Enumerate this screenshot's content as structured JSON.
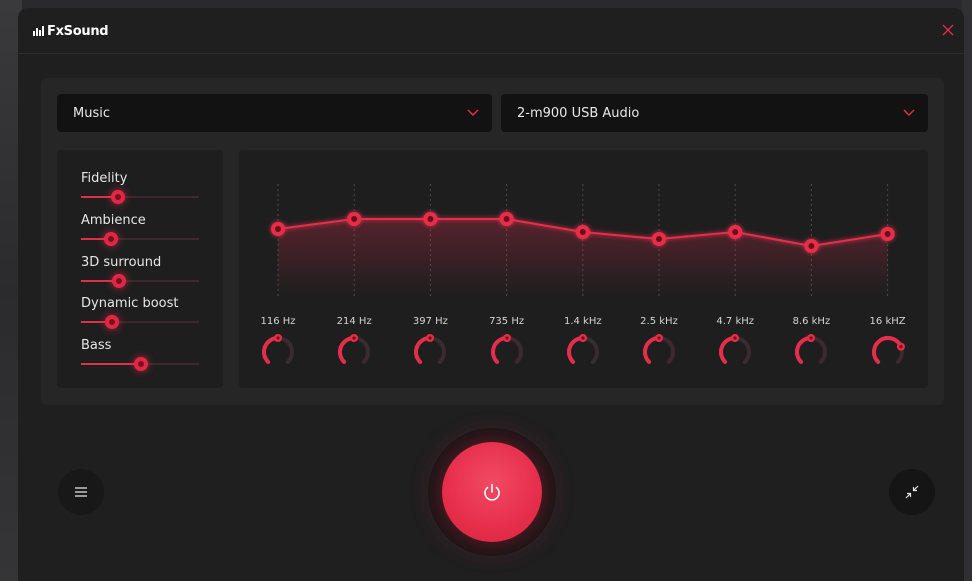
{
  "app": {
    "name": "FxSound"
  },
  "colors": {
    "accent": "#e62e4b",
    "background": "#1f1f20",
    "panel": "#262627"
  },
  "preset_dropdown": {
    "value": "Music"
  },
  "output_dropdown": {
    "value": "2-m900 USB Audio"
  },
  "effects": [
    {
      "label": "Fidelity",
      "value": 0.31
    },
    {
      "label": "Ambience",
      "value": 0.25
    },
    {
      "label": "3D surround",
      "value": 0.32
    },
    {
      "label": "Dynamic boost",
      "value": 0.26
    },
    {
      "label": "Bass",
      "value": 0.51
    }
  ],
  "eq": {
    "bands": [
      {
        "freq": "116 Hz",
        "gain": 0.55
      },
      {
        "freq": "214 Hz",
        "gain": 0.65
      },
      {
        "freq": "397 Hz",
        "gain": 0.65
      },
      {
        "freq": "735 Hz",
        "gain": 0.65
      },
      {
        "freq": "1.4 kHz",
        "gain": 0.52
      },
      {
        "freq": "2.5 kHz",
        "gain": 0.45
      },
      {
        "freq": "4.7 kHz",
        "gain": 0.52
      },
      {
        "freq": "8.6 kHz",
        "gain": 0.38
      },
      {
        "freq": "16 kHZ",
        "gain": 0.5
      }
    ],
    "knobs": [
      0.5,
      0.5,
      0.5,
      0.5,
      0.5,
      0.5,
      0.5,
      0.5,
      0.75
    ]
  },
  "icons": {
    "logo": "fxsound-logo-icon",
    "close": "close-icon",
    "dropdown": "chevron-down-icon",
    "menu": "hamburger-menu-icon",
    "power": "power-icon",
    "shrink": "shrink-icon"
  }
}
